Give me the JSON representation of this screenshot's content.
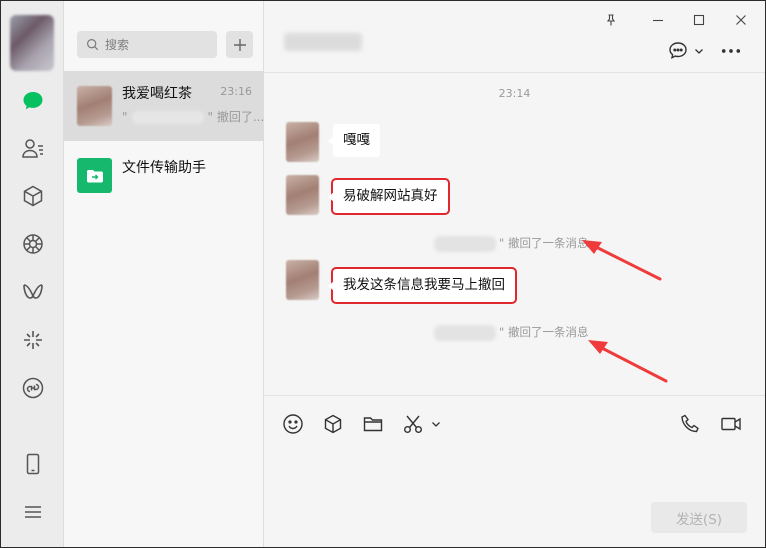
{
  "nav": {
    "items": [
      "chat-icon",
      "contacts-icon",
      "favorites-icon",
      "moments-icon",
      "channels-icon",
      "search-discover-icon",
      "mini-program-icon",
      "phone-icon",
      "menu-icon"
    ],
    "accent": "#07c160"
  },
  "list": {
    "search_placeholder": "搜索",
    "chats": [
      {
        "name": "我爱喝红茶",
        "time": "23:16",
        "preview_prefix": "\"",
        "preview_suffix": "\" 撤回了..."
      },
      {
        "name": "文件传输助手"
      }
    ]
  },
  "main": {
    "timestamp": "23:14",
    "messages": [
      {
        "text": "嘎嘎"
      },
      {
        "text": "易破解网站真好"
      },
      {
        "text": "我发这条信息我要马上撤回"
      }
    ],
    "recall_notice": "\" 撤回了一条消息",
    "send_label": "发送(S)",
    "highlight_color": "#e0282d"
  }
}
